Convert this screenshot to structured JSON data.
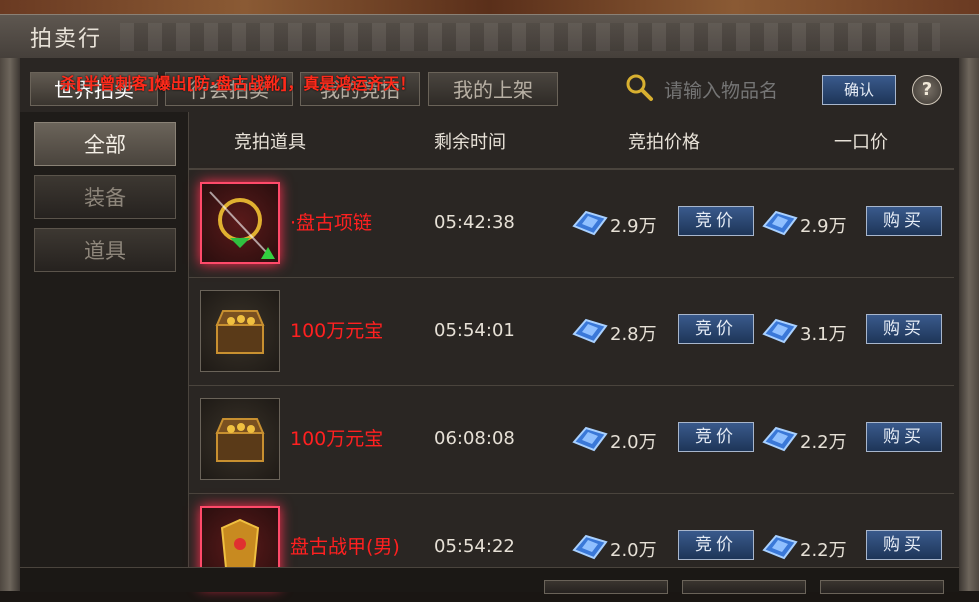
{
  "window": {
    "title": "拍卖行"
  },
  "tabs": [
    "世界拍卖",
    "行会拍卖",
    "我的竞拍",
    "我的上架"
  ],
  "marquee": "杀[半曾刺客]爆出[防·盘古战靴]，真是鸿运齐天！",
  "search": {
    "placeholder": "请输入物品名",
    "confirm_label": "确认",
    "help_label": "?"
  },
  "categories": [
    {
      "label": "全部",
      "active": true
    },
    {
      "label": "装备",
      "active": false
    },
    {
      "label": "道具",
      "active": false
    }
  ],
  "columns": {
    "item": "竞拍道具",
    "time": "剩余时间",
    "bid_price": "竞拍价格",
    "buyout": "一口价"
  },
  "buttons": {
    "bid": "竞价",
    "buy": "购买"
  },
  "rows": [
    {
      "name": "·盘古项链",
      "time": "05:42:38",
      "bid": "2.9万",
      "buyout": "2.9万",
      "icon": "necklace-icon",
      "highlight": true
    },
    {
      "name": "100万元宝",
      "time": "05:54:01",
      "bid": "2.8万",
      "buyout": "3.1万",
      "icon": "treasure-chest-icon",
      "highlight": false
    },
    {
      "name": "100万元宝",
      "time": "06:08:08",
      "bid": "2.0万",
      "buyout": "2.2万",
      "icon": "treasure-chest-icon",
      "highlight": false
    },
    {
      "name": "盘古战甲(男)",
      "time": "05:54:22",
      "bid": "2.0万",
      "buyout": "2.2万",
      "icon": "armor-icon",
      "highlight": true
    }
  ],
  "colors": {
    "item_name": "#ff2020",
    "button_blue": "#2a4878",
    "marquee": "#ff2a1a"
  }
}
